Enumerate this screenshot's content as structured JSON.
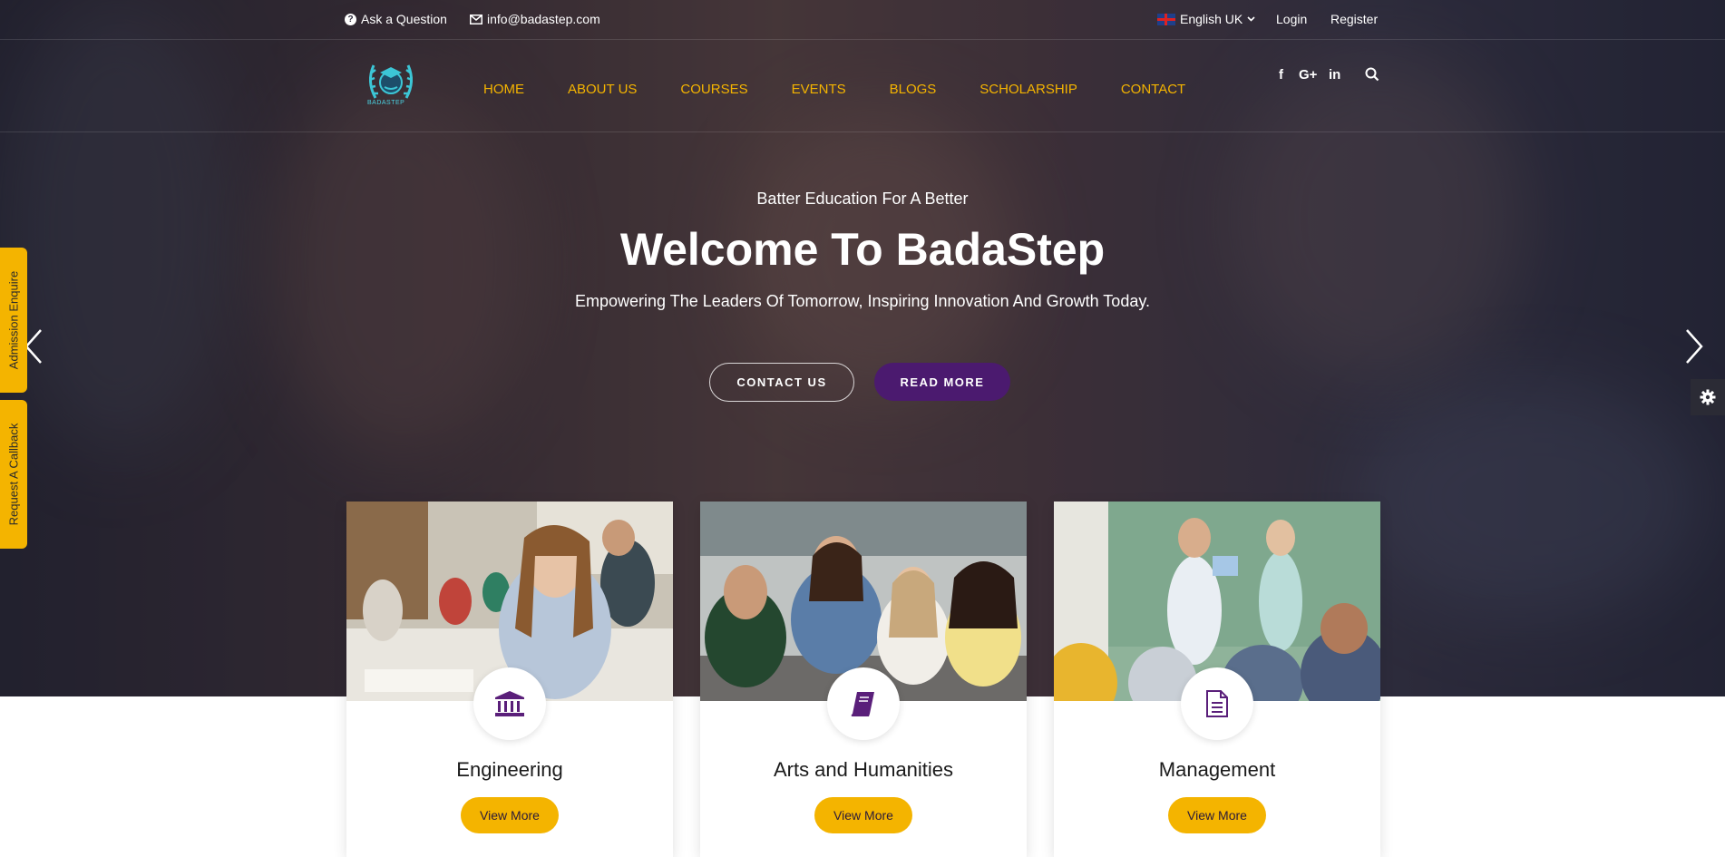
{
  "topbar": {
    "ask_label": "Ask a Question",
    "email_label": "info@badastep.com",
    "language_label": "English UK",
    "login_label": "Login",
    "register_label": "Register"
  },
  "nav": {
    "logo_text": "BADASTEP",
    "items": [
      "HOME",
      "ABOUT US",
      "COURSES",
      "EVENTS",
      "BLOGS",
      "SCHOLARSHIP",
      "CONTACT"
    ],
    "social": {
      "facebook": "f",
      "google_plus": "G+",
      "linkedin": "in"
    }
  },
  "hero": {
    "subtitle": "Batter Education For A Better",
    "title": "Welcome To BadaStep",
    "description": "Empowering The Leaders Of Tomorrow, Inspiring Innovation And Growth Today.",
    "contact_button": "CONTACT US",
    "read_more_button": "READ MORE"
  },
  "side_tabs": {
    "admission": "Admission Enquire",
    "callback": "Request A Callback"
  },
  "cards": [
    {
      "title": "Engineering",
      "button": "View More",
      "icon": "bank-icon"
    },
    {
      "title": "Arts and Humanities",
      "button": "View More",
      "icon": "book-icon"
    },
    {
      "title": "Management",
      "button": "View More",
      "icon": "document-icon"
    }
  ],
  "colors": {
    "accent": "#f4b400",
    "primary": "#4b1a6f",
    "icon_purple": "#5a1f7a"
  }
}
